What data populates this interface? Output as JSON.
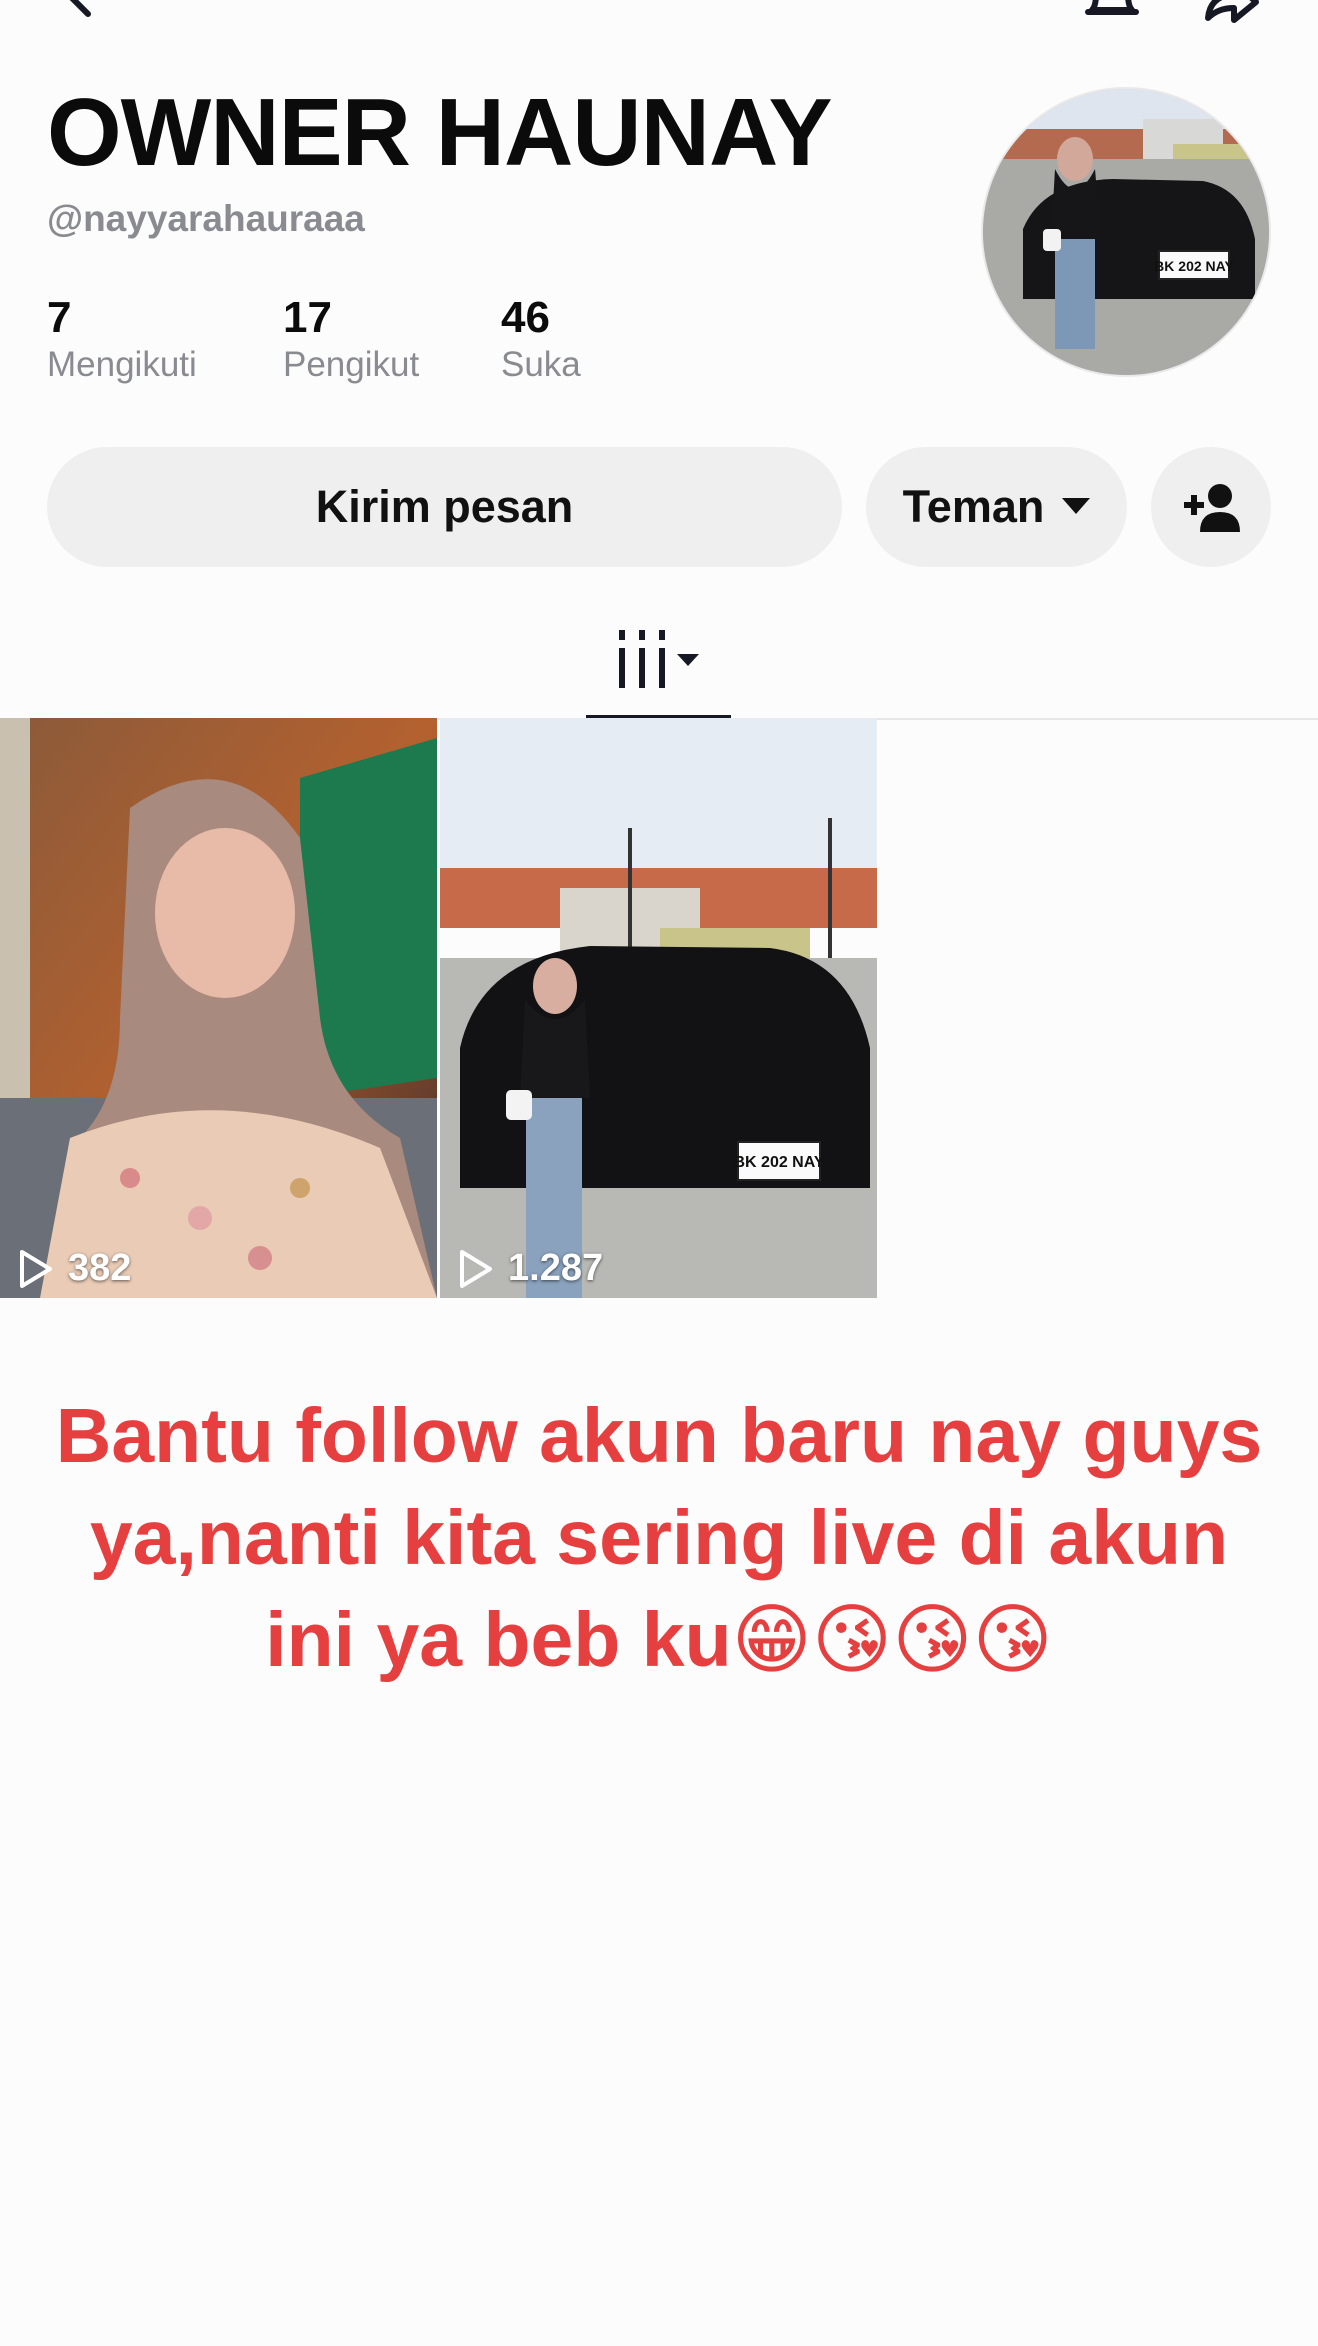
{
  "profile": {
    "display_name": "OWNER HAUNAY",
    "username": "@nayyarahauraaa",
    "stats": [
      {
        "value": "7",
        "label": "Mengikuti"
      },
      {
        "value": "17",
        "label": "Pengikut"
      },
      {
        "value": "46",
        "label": "Suka"
      }
    ]
  },
  "actions": {
    "message_label": "Kirim pesan",
    "friend_label": "Teman"
  },
  "videos": [
    {
      "views": "382"
    },
    {
      "views": "1.287"
    }
  ],
  "avatar_plate": "BK 202 NAY",
  "video2_plate": "BK 202 NAY",
  "promo_text": "Bantu follow akun baru nay guys ya,nanti kita sering live di akun ini ya beb ku😁😘😘😘",
  "colors": {
    "accent_text": "#e5403f",
    "button_bg": "#efefef",
    "muted_text": "#8a8b91"
  },
  "icons": [
    "back-icon",
    "bell-icon",
    "share-icon",
    "caret-down-icon",
    "add-user-icon",
    "videos-grid-icon",
    "play-icon"
  ]
}
